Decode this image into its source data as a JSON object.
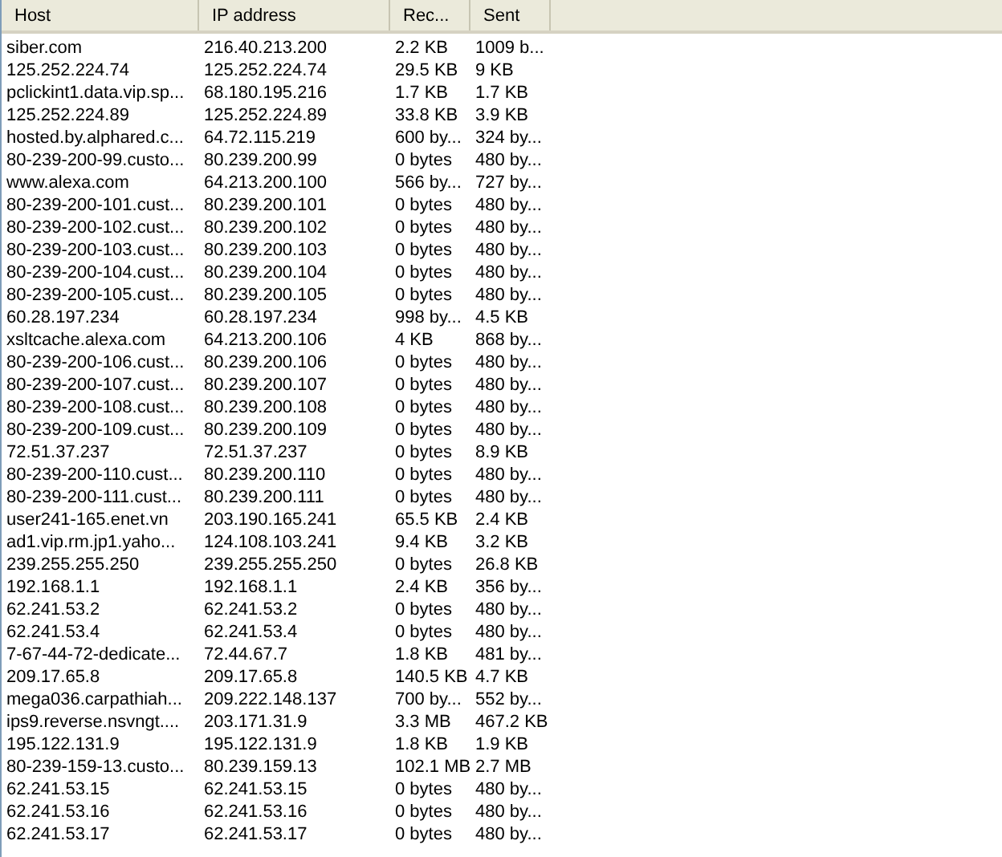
{
  "table": {
    "columns": [
      "Host",
      "IP address",
      "Rec...",
      "Sent"
    ],
    "rows": [
      [
        "siber.com",
        "216.40.213.200",
        "2.2 KB",
        "1009 b..."
      ],
      [
        "125.252.224.74",
        "125.252.224.74",
        "29.5 KB",
        "9 KB"
      ],
      [
        "pclickint1.data.vip.sp...",
        "68.180.195.216",
        "1.7 KB",
        "1.7 KB"
      ],
      [
        "125.252.224.89",
        "125.252.224.89",
        "33.8 KB",
        "3.9 KB"
      ],
      [
        "hosted.by.alphared.c...",
        "64.72.115.219",
        "600 by...",
        "324 by..."
      ],
      [
        "80-239-200-99.custo...",
        "80.239.200.99",
        "0 bytes",
        "480 by..."
      ],
      [
        "www.alexa.com",
        "64.213.200.100",
        "566 by...",
        "727 by..."
      ],
      [
        "80-239-200-101.cust...",
        "80.239.200.101",
        "0 bytes",
        "480 by..."
      ],
      [
        "80-239-200-102.cust...",
        "80.239.200.102",
        "0 bytes",
        "480 by..."
      ],
      [
        "80-239-200-103.cust...",
        "80.239.200.103",
        "0 bytes",
        "480 by..."
      ],
      [
        "80-239-200-104.cust...",
        "80.239.200.104",
        "0 bytes",
        "480 by..."
      ],
      [
        "80-239-200-105.cust...",
        "80.239.200.105",
        "0 bytes",
        "480 by..."
      ],
      [
        "60.28.197.234",
        "60.28.197.234",
        "998 by...",
        "4.5 KB"
      ],
      [
        "xsltcache.alexa.com",
        "64.213.200.106",
        "4 KB",
        "868 by..."
      ],
      [
        "80-239-200-106.cust...",
        "80.239.200.106",
        "0 bytes",
        "480 by..."
      ],
      [
        "80-239-200-107.cust...",
        "80.239.200.107",
        "0 bytes",
        "480 by..."
      ],
      [
        "80-239-200-108.cust...",
        "80.239.200.108",
        "0 bytes",
        "480 by..."
      ],
      [
        "80-239-200-109.cust...",
        "80.239.200.109",
        "0 bytes",
        "480 by..."
      ],
      [
        "72.51.37.237",
        "72.51.37.237",
        "0 bytes",
        "8.9 KB"
      ],
      [
        "80-239-200-110.cust...",
        "80.239.200.110",
        "0 bytes",
        "480 by..."
      ],
      [
        "80-239-200-111.cust...",
        "80.239.200.111",
        "0 bytes",
        "480 by..."
      ],
      [
        "user241-165.enet.vn",
        "203.190.165.241",
        "65.5 KB",
        "2.4 KB"
      ],
      [
        "ad1.vip.rm.jp1.yaho...",
        "124.108.103.241",
        "9.4 KB",
        "3.2 KB"
      ],
      [
        "239.255.255.250",
        "239.255.255.250",
        "0 bytes",
        "26.8 KB"
      ],
      [
        "192.168.1.1",
        "192.168.1.1",
        "2.4 KB",
        "356 by..."
      ],
      [
        "62.241.53.2",
        "62.241.53.2",
        "0 bytes",
        "480 by..."
      ],
      [
        "62.241.53.4",
        "62.241.53.4",
        "0 bytes",
        "480 by..."
      ],
      [
        "7-67-44-72-dedicate...",
        "72.44.67.7",
        "1.8 KB",
        "481 by..."
      ],
      [
        "209.17.65.8",
        "209.17.65.8",
        "140.5 KB",
        "4.7 KB"
      ],
      [
        "mega036.carpathiah...",
        "209.222.148.137",
        "700 by...",
        "552 by..."
      ],
      [
        "ips9.reverse.nsvngt....",
        "203.171.31.9",
        "3.3 MB",
        "467.2 KB"
      ],
      [
        "195.122.131.9",
        "195.122.131.9",
        "1.8 KB",
        "1.9 KB"
      ],
      [
        "80-239-159-13.custo...",
        "80.239.159.13",
        "102.1 MB",
        "2.7 MB"
      ],
      [
        "62.241.53.15",
        "62.241.53.15",
        "0 bytes",
        "480 by..."
      ],
      [
        "62.241.53.16",
        "62.241.53.16",
        "0 bytes",
        "480 by..."
      ],
      [
        "62.241.53.17",
        "62.241.53.17",
        "0 bytes",
        "480 by..."
      ]
    ]
  }
}
